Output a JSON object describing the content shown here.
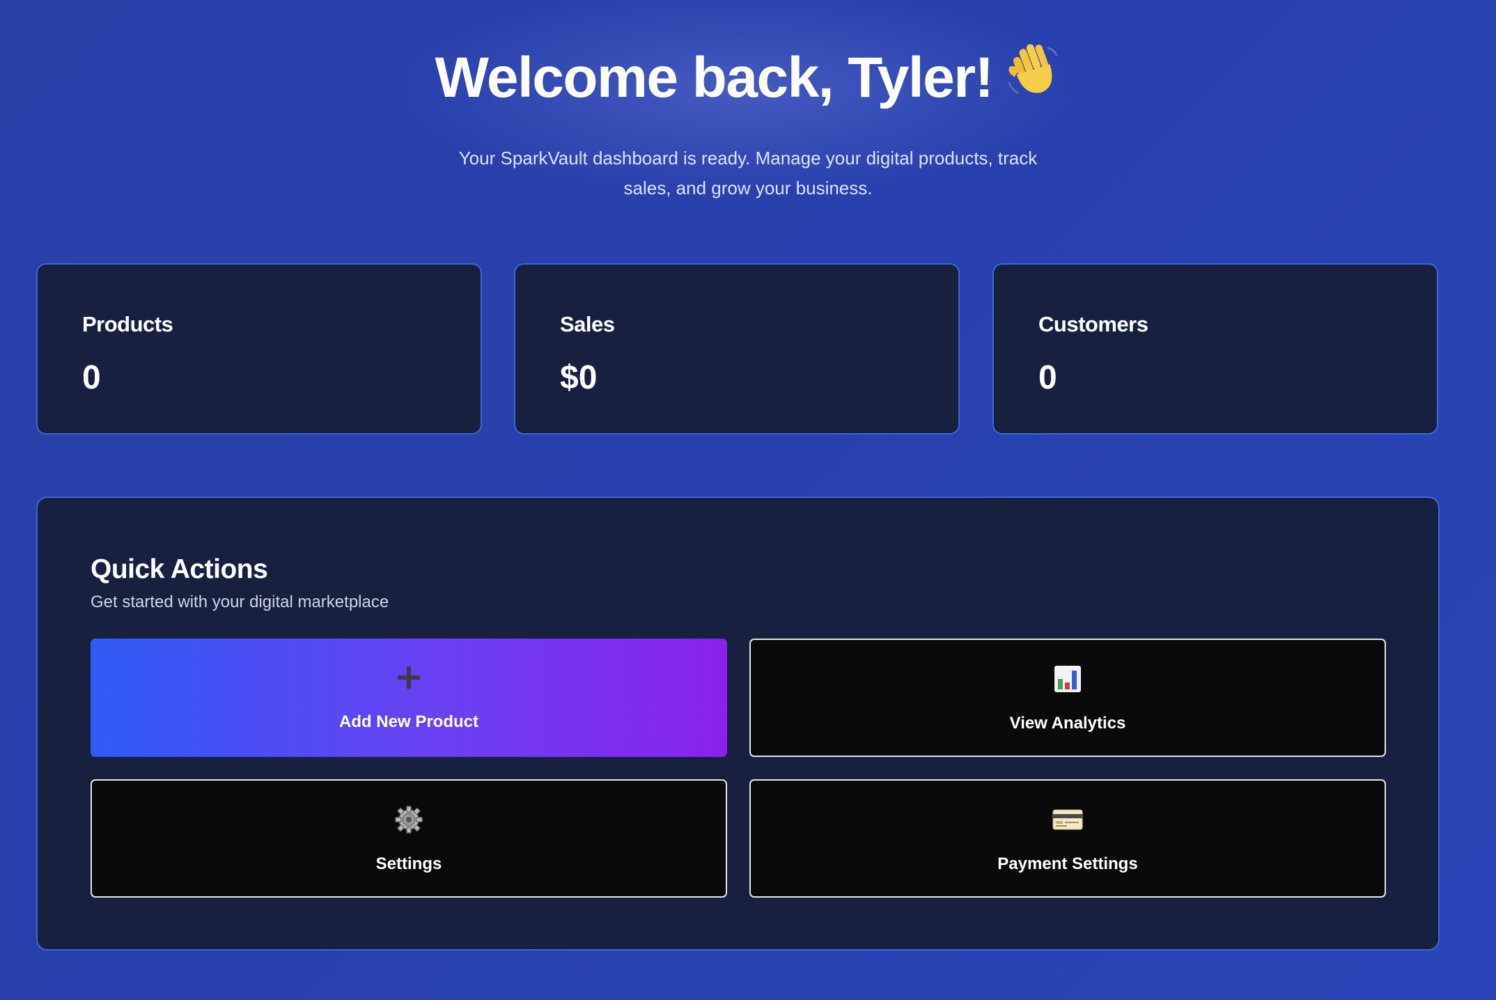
{
  "hero": {
    "title": "Welcome back, Tyler!",
    "title_icon": "waving-hand-icon",
    "subtitle": "Your SparkVault dashboard is ready. Manage your digital products, track sales, and grow your business."
  },
  "stats": [
    {
      "label": "Products",
      "value": "0"
    },
    {
      "label": "Sales",
      "value": "$0"
    },
    {
      "label": "Customers",
      "value": "0"
    }
  ],
  "quick_actions": {
    "title": "Quick Actions",
    "subtitle": "Get started with your digital marketplace",
    "actions": [
      {
        "label": "Add New Product",
        "icon": "plus-icon",
        "style": "primary"
      },
      {
        "label": "View Analytics",
        "icon": "bar-chart-icon",
        "style": "secondary"
      },
      {
        "label": "Settings",
        "icon": "gear-icon",
        "style": "secondary"
      },
      {
        "label": "Payment Settings",
        "icon": "credit-card-icon",
        "style": "secondary"
      }
    ]
  },
  "colors": {
    "background": "#2a40ad",
    "card": "#17203f",
    "card_border": "#3f66d9",
    "primary_gradient_start": "#2f5bf5",
    "primary_gradient_end": "#8a22ec",
    "secondary_button": "#0a0a0a"
  }
}
